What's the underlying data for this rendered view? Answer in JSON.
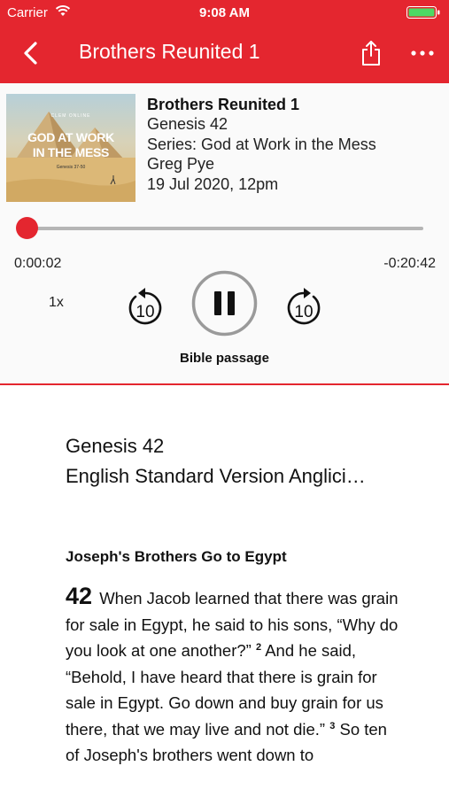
{
  "status_bar": {
    "carrier": "Carrier",
    "time": "9:08 AM"
  },
  "nav": {
    "title": "Brothers Reunited 1"
  },
  "artwork": {
    "small_text": "CLEM ONLINE",
    "title_line1": "GOD AT WORK",
    "title_line2": "IN THE MESS",
    "reference": "Genesis 37-50"
  },
  "episode": {
    "title": "Brothers Reunited 1",
    "passage": "Genesis 42",
    "series": "Series: God at Work in the Mess",
    "speaker": "Greg Pye",
    "date": "19 Jul 2020, 12pm"
  },
  "player": {
    "elapsed": "0:00:02",
    "remaining": "-0:20:42",
    "progress": 0.002,
    "speed": "1x",
    "skip_back_seconds": "10",
    "skip_forward_seconds": "10",
    "state": "playing",
    "passage_label": "Bible passage"
  },
  "bible": {
    "reference": "Genesis 42",
    "version": "English Standard Version Anglici…",
    "heading": "Joseph's Brothers Go to Egypt",
    "chapter": "42",
    "verse1": "When Jacob learned that there was grain for sale in Egypt, he said to his sons, “Why do you look at one another?”",
    "verse2_num": "2",
    "verse2": "And he said, “Behold, I have heard that there is grain for sale in Egypt. Go down and buy grain for us there, that we may live and not die.”",
    "verse3_num": "3",
    "verse3": "So ten of Joseph's brothers went down to"
  },
  "colors": {
    "accent": "#e4262f"
  }
}
